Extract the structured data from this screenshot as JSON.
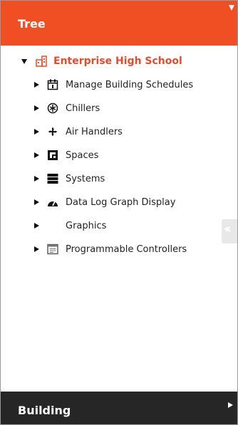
{
  "header": {
    "title": "Tree"
  },
  "tree": {
    "root": {
      "label": "Enterprise High School",
      "expanded": true,
      "icon": "building-icon"
    },
    "children": [
      {
        "label": "Manage Building Schedules",
        "icon": "calendar-icon"
      },
      {
        "label": "Chillers",
        "icon": "chiller-icon"
      },
      {
        "label": "Air Handlers",
        "icon": "fan-icon"
      },
      {
        "label": "Spaces",
        "icon": "space-icon"
      },
      {
        "label": "Systems",
        "icon": "systems-icon"
      },
      {
        "label": "Data Log Graph Display",
        "icon": "gauge-icon"
      },
      {
        "label": "Graphics",
        "icon": ""
      },
      {
        "label": "Programmable Controllers",
        "icon": "controller-icon"
      }
    ]
  },
  "footer": {
    "title": "Building"
  },
  "colors": {
    "accent": "#f04e23",
    "footer_bg": "#262626",
    "root_text": "#e84b2b"
  }
}
